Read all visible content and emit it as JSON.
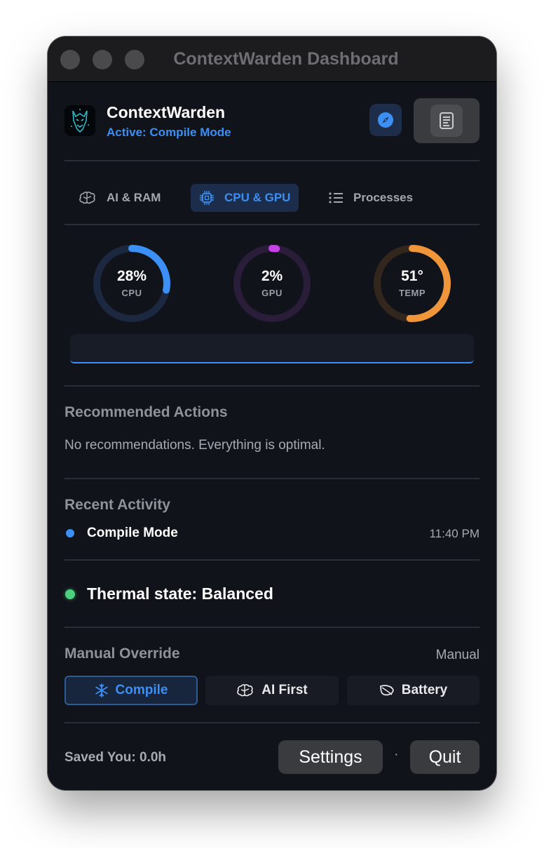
{
  "window": {
    "title": "ContextWarden Dashboard"
  },
  "header": {
    "app_name": "ContextWarden",
    "status": "Active: Compile Mode",
    "compass_icon": "compass-icon",
    "report_icon": "document-icon"
  },
  "tabs": [
    {
      "label": "AI & RAM",
      "icon": "brain-icon",
      "active": false
    },
    {
      "label": "CPU & GPU",
      "icon": "chip-icon",
      "active": true
    },
    {
      "label": "Processes",
      "icon": "list-icon",
      "active": false
    }
  ],
  "gauges": [
    {
      "value_text": "28%",
      "label": "CPU",
      "fraction": 0.28,
      "color": "#3b8ff5",
      "track": "#1c2840"
    },
    {
      "value_text": "2%",
      "label": "GPU",
      "fraction": 0.02,
      "color": "#c840e8",
      "track": "#2a1d3a"
    },
    {
      "value_text": "51°",
      "label": "TEMP",
      "fraction": 0.51,
      "color": "#f0963a",
      "track": "#33261d"
    }
  ],
  "recommendations": {
    "title": "Recommended Actions",
    "text": "No recommendations. Everything is optimal."
  },
  "activity": {
    "title": "Recent Activity",
    "items": [
      {
        "name": "Compile Mode",
        "time": "11:40 PM",
        "color": "#3b8ff5"
      }
    ]
  },
  "thermal": {
    "text": "Thermal state: Balanced",
    "color": "#4cd07d"
  },
  "override": {
    "title": "Manual Override",
    "mode_label": "Manual",
    "modes": [
      {
        "label": "Compile",
        "icon": "snowflake-icon",
        "selected": true
      },
      {
        "label": "AI First",
        "icon": "brain-icon",
        "selected": false
      },
      {
        "label": "Battery",
        "icon": "leaf-icon",
        "selected": false
      }
    ]
  },
  "footer": {
    "saved": "Saved You: 0.0h",
    "separator": "·",
    "settings_label": "Settings",
    "quit_label": "Quit"
  },
  "colors": {
    "accent": "#3b8ff5",
    "background": "#10131a"
  }
}
